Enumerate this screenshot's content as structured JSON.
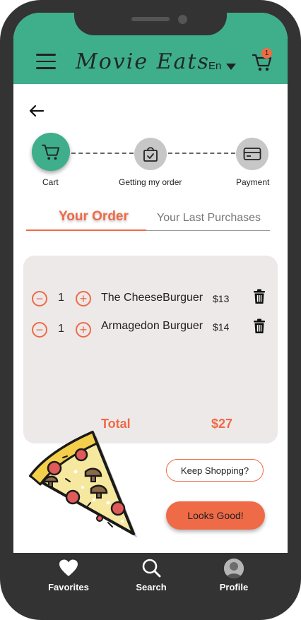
{
  "header": {
    "brand": "Movie Eats",
    "language": "En",
    "cart_count": "1",
    "colors": {
      "header_bg": "#3fae8b",
      "accent": "#ef6a47",
      "dark": "#333333"
    }
  },
  "progress": {
    "steps": [
      {
        "label": "Cart",
        "icon": "cart-icon",
        "active": true
      },
      {
        "label": "Getting my order",
        "icon": "bag-check-icon",
        "active": false
      },
      {
        "label": "Payment",
        "icon": "credit-card-icon",
        "active": false
      }
    ]
  },
  "tabs": [
    {
      "label": "Your Order",
      "active": true
    },
    {
      "label": "Your Last Purchases",
      "active": false
    }
  ],
  "order": {
    "items": [
      {
        "qty": "1",
        "name": "The CheeseBurguer",
        "price": "$13"
      },
      {
        "qty": "1",
        "name": "Armagedon Burguer",
        "price": "$14"
      }
    ],
    "total_label": "Total",
    "total_value": "$27"
  },
  "actions": {
    "keep_shopping": "Keep Shopping?",
    "looks_good": "Looks Good!"
  },
  "bottom_nav": [
    {
      "label": "Favorites",
      "icon": "heart-icon"
    },
    {
      "label": "Search",
      "icon": "search-icon"
    },
    {
      "label": "Profile",
      "icon": "avatar"
    }
  ]
}
